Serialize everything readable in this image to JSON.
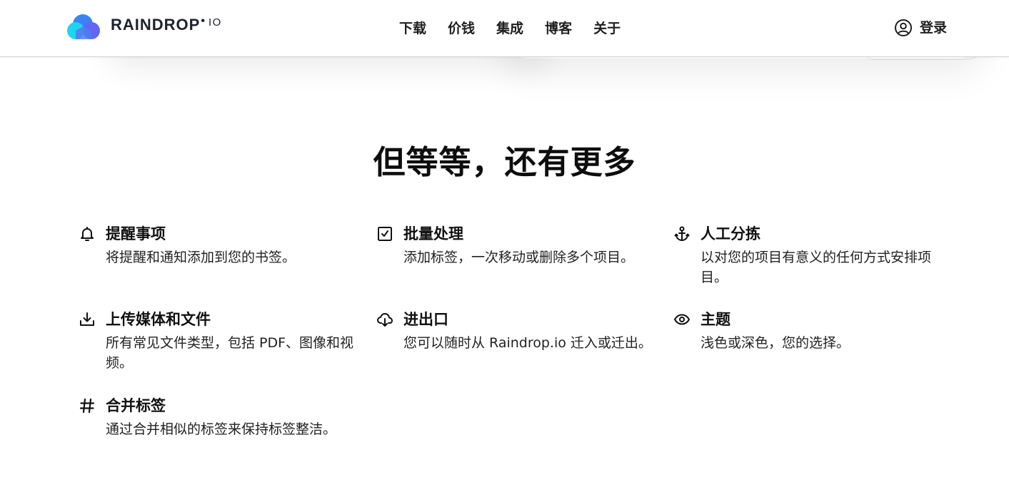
{
  "header": {
    "logo": {
      "name": "RAINDROP",
      "dot": "•",
      "suffix": "IO"
    },
    "nav": [
      {
        "label": "下载"
      },
      {
        "label": "价钱"
      },
      {
        "label": "集成"
      },
      {
        "label": "博客"
      },
      {
        "label": "关于"
      }
    ],
    "login": {
      "label": "登录",
      "icon": "user-circle-icon"
    }
  },
  "main": {
    "title": "但等等，还有更多",
    "features": [
      {
        "icon": "bell-icon",
        "title": "提醒事项",
        "desc": "将提醒和通知添加到您的书签。"
      },
      {
        "icon": "checkbox-icon",
        "title": "批量处理",
        "desc": "添加标签，一次移动或删除多个项目。"
      },
      {
        "icon": "anchor-icon",
        "title": "人工分拣",
        "desc": "以对您的项目有意义的任何方式安排项目。"
      },
      {
        "icon": "download-icon",
        "title": "上传媒体和文件",
        "desc": "所有常见文件类型，包括 PDF、图像和视频。"
      },
      {
        "icon": "cloud-download-icon",
        "title": "进出口",
        "desc": "您可以随时从 Raindrop.io 迁入或迁出。"
      },
      {
        "icon": "eye-icon",
        "title": "主题",
        "desc": "浅色或深色，您的选择。"
      },
      {
        "icon": "hashtag-icon",
        "title": "合并标签",
        "desc": "通过合并相似的标签来保持标签整洁。"
      }
    ]
  },
  "colors": {
    "logo_cyan": "#22d3ee",
    "logo_blue": "#3b82f6",
    "logo_indigo": "#6366f1",
    "text": "#111111",
    "header_border": "#d4d4d4"
  }
}
